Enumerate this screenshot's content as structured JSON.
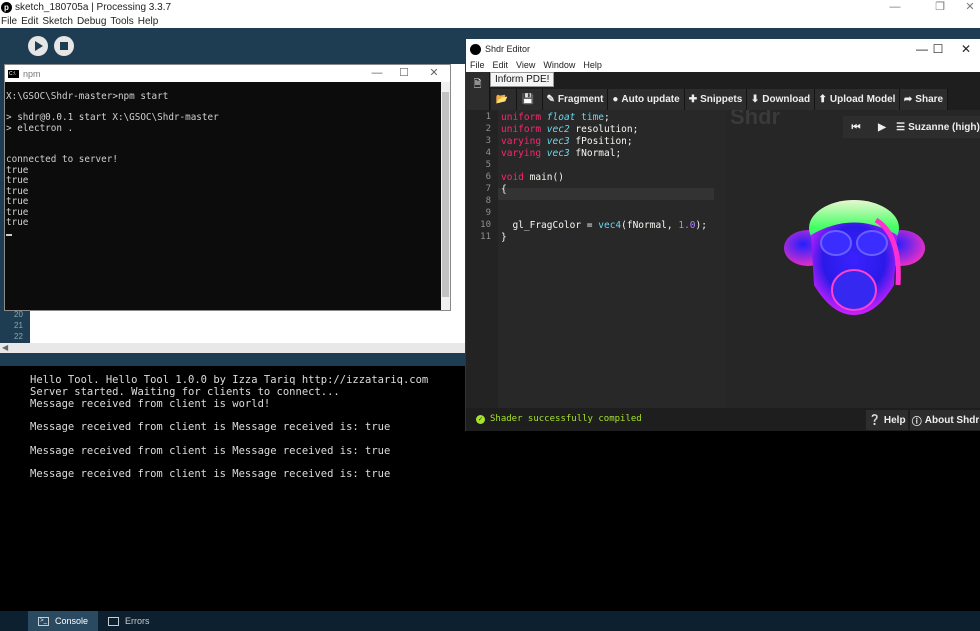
{
  "pde": {
    "title": "sketch_180705a | Processing 3.3.7",
    "menu": [
      "File",
      "Edit",
      "Sketch",
      "Debug",
      "Tools",
      "Help"
    ],
    "gutter_lines": [
      "20",
      "21",
      "22"
    ],
    "console_lines": [
      "Hello Tool. Hello Tool 1.0.0 by Izza Tariq http://izzatariq.com",
      "Server started. Waiting for clients to connect...",
      "Message received from client is world!",
      "",
      "Message received from client is Message received is: true",
      "",
      "Message received from client is Message received is: true",
      "",
      "Message received from client is Message received is: true"
    ],
    "footer": {
      "console_label": "Console",
      "errors_label": "Errors"
    }
  },
  "npm": {
    "title": "npm",
    "lines": [
      "X:\\GSOC\\Shdr-master>npm start",
      "",
      "> shdr@0.0.1 start X:\\GSOC\\Shdr-master",
      "> electron .",
      "",
      "",
      "connected to server!",
      "true",
      "true",
      "true",
      "true",
      "true",
      "true"
    ]
  },
  "shdr": {
    "title": "Shdr Editor",
    "menu": [
      "File",
      "Edit",
      "View",
      "Window",
      "Help"
    ],
    "tooltip": "Inform PDE!",
    "toolbar": {
      "fragment": "Fragment",
      "auto_update": "Auto update",
      "snippets": "Snippets",
      "download": "Download",
      "upload_model": "Upload Model",
      "share": "Share"
    },
    "code": {
      "line_numbers": [
        "1",
        "2",
        "3",
        "4",
        "5",
        "6",
        "7",
        "8",
        "9",
        "10",
        "11"
      ],
      "l1": {
        "kw": "uniform",
        "ty": "float",
        "id": "time",
        "end": ";"
      },
      "l2": {
        "kw": "uniform",
        "ty": "vec2",
        "id": "resolution;"
      },
      "l3": {
        "kw": "varying",
        "ty": "vec3",
        "id": "fPosition;"
      },
      "l4": {
        "kw": "varying",
        "ty": "vec3",
        "id": "fNormal;"
      },
      "l6": {
        "ty": "void",
        "id": "main()"
      },
      "l7": "{",
      "l10": {
        "id": "gl_FragColor = ",
        "fn": "vec4",
        "args_a": "(fNormal, ",
        "num": "1.0",
        "args_b": ");"
      },
      "l11": "}"
    },
    "preview": {
      "watermark": "Shdr",
      "model": "Suzanne (high)"
    },
    "status": "Shader successfully compiled",
    "help": "Help",
    "about": "About Shdr"
  }
}
